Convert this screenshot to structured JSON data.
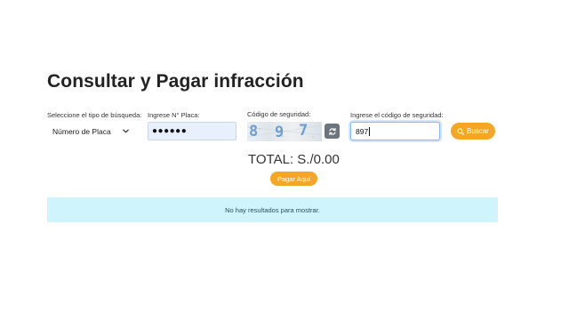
{
  "page": {
    "title": "Consultar y Pagar infracción"
  },
  "form": {
    "search_type": {
      "label": "Seleccione el tipo de búsqueda:",
      "selected": "Número de Placa"
    },
    "plate": {
      "label": "Ingrese N° Placa:",
      "value": "●●●●●●"
    },
    "captcha": {
      "label": "Código de seguridad:",
      "digits": [
        "8",
        "9",
        "7"
      ]
    },
    "code_input": {
      "label": "Ingrese el código de seguridad:",
      "value": "897"
    },
    "search_button": {
      "label": "Buscar"
    }
  },
  "summary": {
    "total": "TOTAL: S./0.00",
    "pay_button": "Pagar Aquí"
  },
  "results": {
    "empty_message": "No hay resultados para mostrar."
  },
  "colors": {
    "accent": "#f5a623",
    "info_bg": "#cff4fc",
    "autofill_bg": "#e8f0fe",
    "captcha_digit": "#6f9fd0",
    "refresh_btn": "#6c757d"
  },
  "icons": {
    "select": "chevron-down-icon",
    "refresh": "refresh-icon",
    "search": "search-icon"
  }
}
